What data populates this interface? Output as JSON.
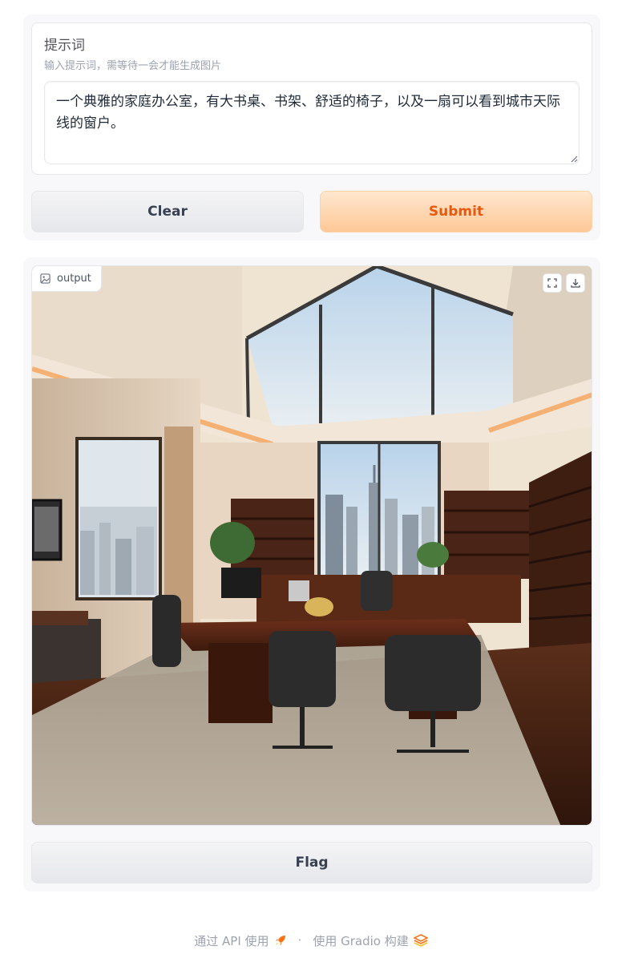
{
  "prompt": {
    "label": "提示词",
    "info": "输入提示词，需等待一会才能生成图片",
    "value": "一个典雅的家庭办公室，有大书桌、书架、舒适的椅子，以及一扇可以看到城市天际线的窗户。"
  },
  "buttons": {
    "clear_label": "Clear",
    "submit_label": "Submit",
    "flag_label": "Flag"
  },
  "output": {
    "label": "output",
    "image_alt_icon": "image-icon",
    "fullscreen_icon": "fullscreen-icon",
    "download_icon": "download-icon"
  },
  "footer": {
    "api_text": "通过 API 使用",
    "separator": "·",
    "built_text": "使用 Gradio 构建"
  },
  "colors": {
    "submit_text": "#ea580c",
    "submit_bg_from": "#ffe7cf",
    "submit_bg_to": "#fdc896",
    "neutral_btn_text": "#374151",
    "panel_bg": "#f8f8fa"
  }
}
